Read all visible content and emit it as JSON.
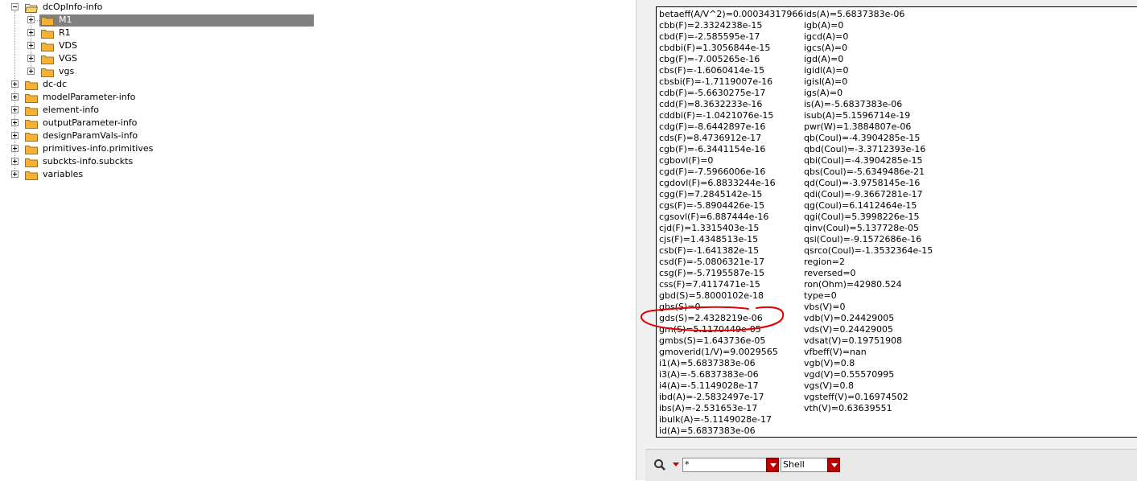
{
  "tree": {
    "root": {
      "label": "dcOpInfo-info",
      "expanded": true
    },
    "children": [
      {
        "label": "M1",
        "selected": true
      },
      {
        "label": "R1"
      },
      {
        "label": "VDS"
      },
      {
        "label": "VGS"
      },
      {
        "label": "vgs"
      }
    ],
    "siblings": [
      {
        "label": "dc-dc"
      },
      {
        "label": "modelParameter-info"
      },
      {
        "label": "element-info"
      },
      {
        "label": "outputParameter-info"
      },
      {
        "label": "designParamVals-info"
      },
      {
        "label": "primitives-info.primitives"
      },
      {
        "label": "subckts-info.subckts"
      },
      {
        "label": "variables"
      }
    ]
  },
  "info_panel": {
    "column1": [
      "betaeff(A/V^2)=0.00034317966",
      "cbb(F)=2.3324238e-15",
      "cbd(F)=-2.585595e-17",
      "cbdbi(F)=1.3056844e-15",
      "cbg(F)=-7.005265e-16",
      "cbs(F)=-1.6060414e-15",
      "cbsbi(F)=-1.7119007e-16",
      "cdb(F)=-5.6630275e-17",
      "cdd(F)=8.3632233e-16",
      "cddbi(F)=-1.0421076e-15",
      "cdg(F)=-8.6442897e-16",
      "cds(F)=8.4736912e-17",
      "cgb(F)=-6.3441154e-16",
      "cgbovl(F)=0",
      "cgd(F)=-7.5966006e-16",
      "cgdovl(F)=6.8833244e-16",
      "cgg(F)=7.2845142e-15",
      "cgs(F)=-5.8904426e-15",
      "cgsovl(F)=6.887444e-16",
      "cjd(F)=1.3315403e-15",
      "cjs(F)=1.4348513e-15",
      "csb(F)=-1.641382e-15",
      "csd(F)=-5.0806321e-17",
      "csg(F)=-5.7195587e-15",
      "css(F)=7.4117471e-15",
      "gbd(S)=5.8000102e-18",
      "gbs(S)=0",
      "gds(S)=2.4328219e-06",
      "gm(S)=5.1170449e-05",
      "gmbs(S)=1.643736e-05",
      "gmoverid(1/V)=9.0029565",
      "i1(A)=5.6837383e-06",
      "i3(A)=-5.6837383e-06",
      "i4(A)=-5.1149028e-17",
      "ibd(A)=-2.5832497e-17",
      "ibs(A)=-2.531653e-17",
      "ibulk(A)=-5.1149028e-17",
      "id(A)=5.6837383e-06"
    ],
    "column2": [
      "ids(A)=5.6837383e-06",
      "igb(A)=0",
      "igcd(A)=0",
      "igcs(A)=0",
      "igd(A)=0",
      "igidl(A)=0",
      "igisl(A)=0",
      "igs(A)=0",
      "is(A)=-5.6837383e-06",
      "isub(A)=5.1596714e-19",
      "pwr(W)=1.3884807e-06",
      "qb(Coul)=-4.3904285e-15",
      "qbd(Coul)=-3.3712393e-16",
      "qbi(Coul)=-4.3904285e-15",
      "qbs(Coul)=-5.6349486e-21",
      "qd(Coul)=-3.9758145e-16",
      "qdi(Coul)=-9.3667281e-17",
      "qg(Coul)=6.1412464e-15",
      "qgi(Coul)=5.3998226e-15",
      "qinv(Coul)=5.137728e-05",
      "qsi(Coul)=-9.1572686e-16",
      "qsrco(Coul)=-1.3532364e-15",
      "region=2",
      "reversed=0",
      "ron(Ohm)=42980.524",
      "type=0",
      "vbs(V)=0",
      "vdb(V)=0.24429005",
      "vds(V)=0.24429005",
      "vdsat(V)=0.19751908",
      "vfbeff(V)=nan",
      "vgb(V)=0.8",
      "vgd(V)=0.55570995",
      "vgs(V)=0.8",
      "vgsteff(V)=0.16974502",
      "vth(V)=0.63639551"
    ]
  },
  "annotation": {
    "color": "#e00000",
    "highlights": "gds(S)=2.4328219e-06"
  },
  "toolbar": {
    "search_icon": "magnifier-icon",
    "filter_value": "*",
    "shell_value": "Shell",
    "dropdown_color": "#c00000"
  }
}
